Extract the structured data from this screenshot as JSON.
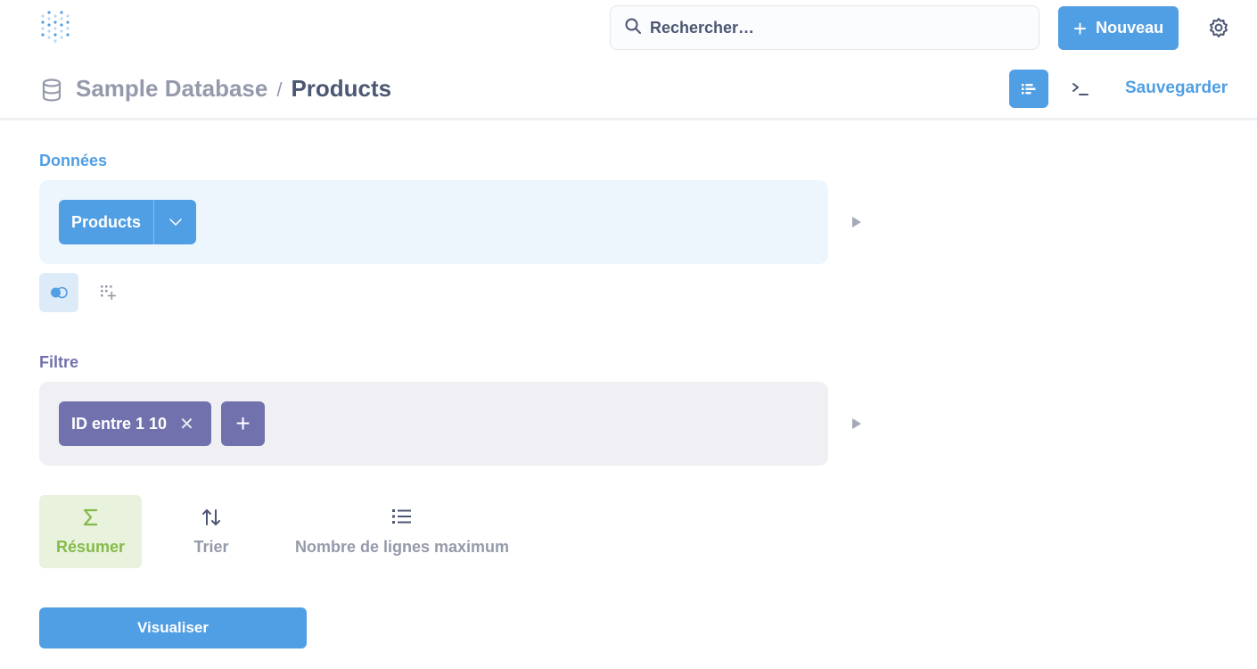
{
  "nav": {
    "search_placeholder": "Rechercher…",
    "new_button": "Nouveau",
    "new_icon": "+"
  },
  "header": {
    "database": "Sample Database",
    "separator": "/",
    "table": "Products",
    "save": "Sauvegarder"
  },
  "editor": {
    "data_label": "Données",
    "data_table": "Products",
    "filter_label": "Filtre",
    "filter_pill": "ID entre 1 10",
    "filter_remove": "✕",
    "add_filter": "+",
    "steps": {
      "summarize": "Résumer",
      "sort": "Trier",
      "limit": "Nombre de lignes maximum"
    },
    "visualize": "Visualiser"
  },
  "colors": {
    "brand": "#509ee3",
    "filter": "#7172ad",
    "summarize": "#84bb4c"
  }
}
